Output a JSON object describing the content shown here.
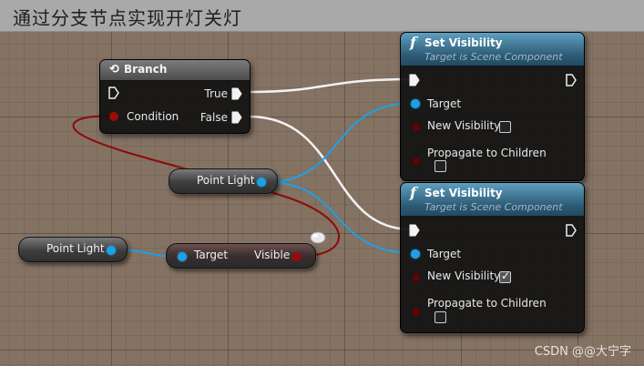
{
  "page_title": "通过分支节点实现开灯关灯",
  "branch_node": {
    "title": "Branch",
    "icon": "branch-icon",
    "true_label": "True",
    "false_label": "False",
    "condition_label": "Condition"
  },
  "set_visibility_1": {
    "title": "Set Visibility",
    "subtitle": "Target is Scene Component",
    "icon": "function-icon",
    "target_label": "Target",
    "new_visibility_label": "New Visibility",
    "new_visibility_checked": false,
    "propagate_label": "Propagate to Children",
    "propagate_checked": false
  },
  "set_visibility_2": {
    "title": "Set Visibility",
    "subtitle": "Target is Scene Component",
    "icon": "function-icon",
    "target_label": "Target",
    "new_visibility_label": "New Visibility",
    "new_visibility_checked": true,
    "propagate_label": "Propagate to Children",
    "propagate_checked": false
  },
  "point_light_node_1": {
    "label": "Point Light"
  },
  "point_light_node_2": {
    "label": "Point Light"
  },
  "visible_getter": {
    "target_label": "Target",
    "visible_label": "Visible"
  },
  "watermark": "CSDN @@大宁字",
  "colors": {
    "graph_background": "#847263",
    "title_bar": "#a9a9a9",
    "exec_wire": "#f2f2f2",
    "object_wire": "#1ea0e6",
    "bool_wire": "#9b0b0b",
    "function_header": "#2c5a75"
  }
}
